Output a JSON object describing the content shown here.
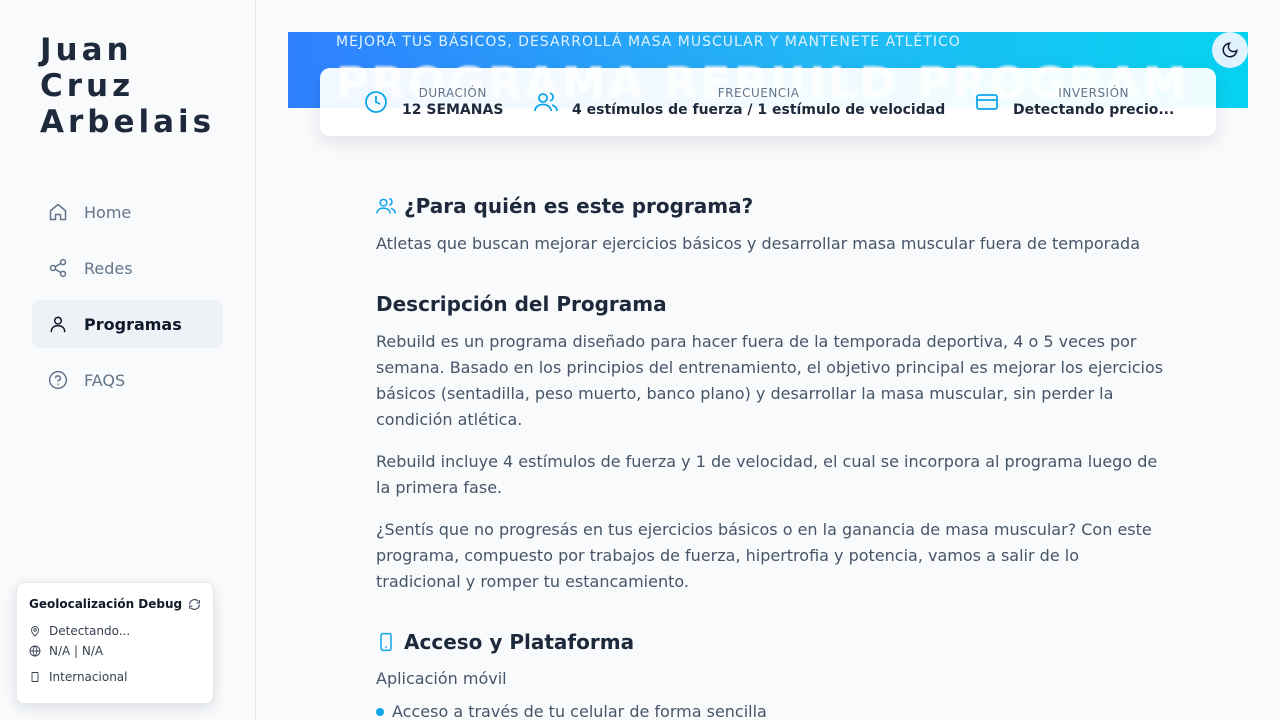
{
  "brand": {
    "line1": "Juan",
    "line2": "Cruz",
    "line3": "Arbelais"
  },
  "nav": [
    {
      "label": "Home",
      "icon": "home-icon"
    },
    {
      "label": "Redes",
      "icon": "share-icon"
    },
    {
      "label": "Programas",
      "icon": "user-icon",
      "active": true
    },
    {
      "label": "FAQS",
      "icon": "help-circle-icon"
    }
  ],
  "sidebar_partial_text": "s",
  "debug": {
    "title": "Geolocalización Debug",
    "location": "Detectando...",
    "ip_country": "N/A | N/A",
    "region": "Internacional"
  },
  "hero": {
    "subtitle": "MEJORÁ TUS BÁSICOS, DESARROLLÁ MASA MUSCULAR Y MANTENETE ATLÉTICO",
    "title": "PROGRAMA REBUILD PROGRAM"
  },
  "stats": {
    "duration": {
      "label": "DURACIÓN",
      "value": "12 SEMANAS"
    },
    "frequency": {
      "label": "FRECUENCIA",
      "value": "4 estímulos de fuerza / 1 estímulo de velocidad"
    },
    "investment": {
      "label": "INVERSIÓN",
      "value": "Detectando precio..."
    }
  },
  "content": {
    "audience_title": "¿Para quién es este programa?",
    "audience_text": "Atletas que buscan mejorar ejercicios básicos y desarrollar masa muscular fuera de temporada",
    "description_title": "Descripción del Programa",
    "description_p1": "Rebuild es un programa diseñado para hacer fuera de la temporada deportiva, 4 o 5 veces por semana. Basado en los principios del entrenamiento, el objetivo principal es mejorar los ejercicios básicos (sentadilla, peso muerto, banco plano) y desarrollar la masa muscular, sin perder la condición atlética.",
    "description_p2": "Rebuild incluye 4 estímulos de fuerza y 1 de velocidad, el cual se incorpora al programa luego de la primera fase.",
    "description_p3": "¿Sentís que no progresás en tus ejercicios básicos o en la ganancia de masa muscular? Con este programa, compuesto por trabajos de fuerza, hipertrofia y potencia, vamos a salir de lo tradicional y romper tu estancamiento.",
    "access_title": "Acceso y Plataforma",
    "access_text": "Aplicación móvil",
    "access_item1": "Acceso a través de tu celular de forma sencilla"
  },
  "colors": {
    "accent": "#0ea5e9",
    "hero_start": "#2f80ff",
    "hero_end": "#06d3f0"
  }
}
